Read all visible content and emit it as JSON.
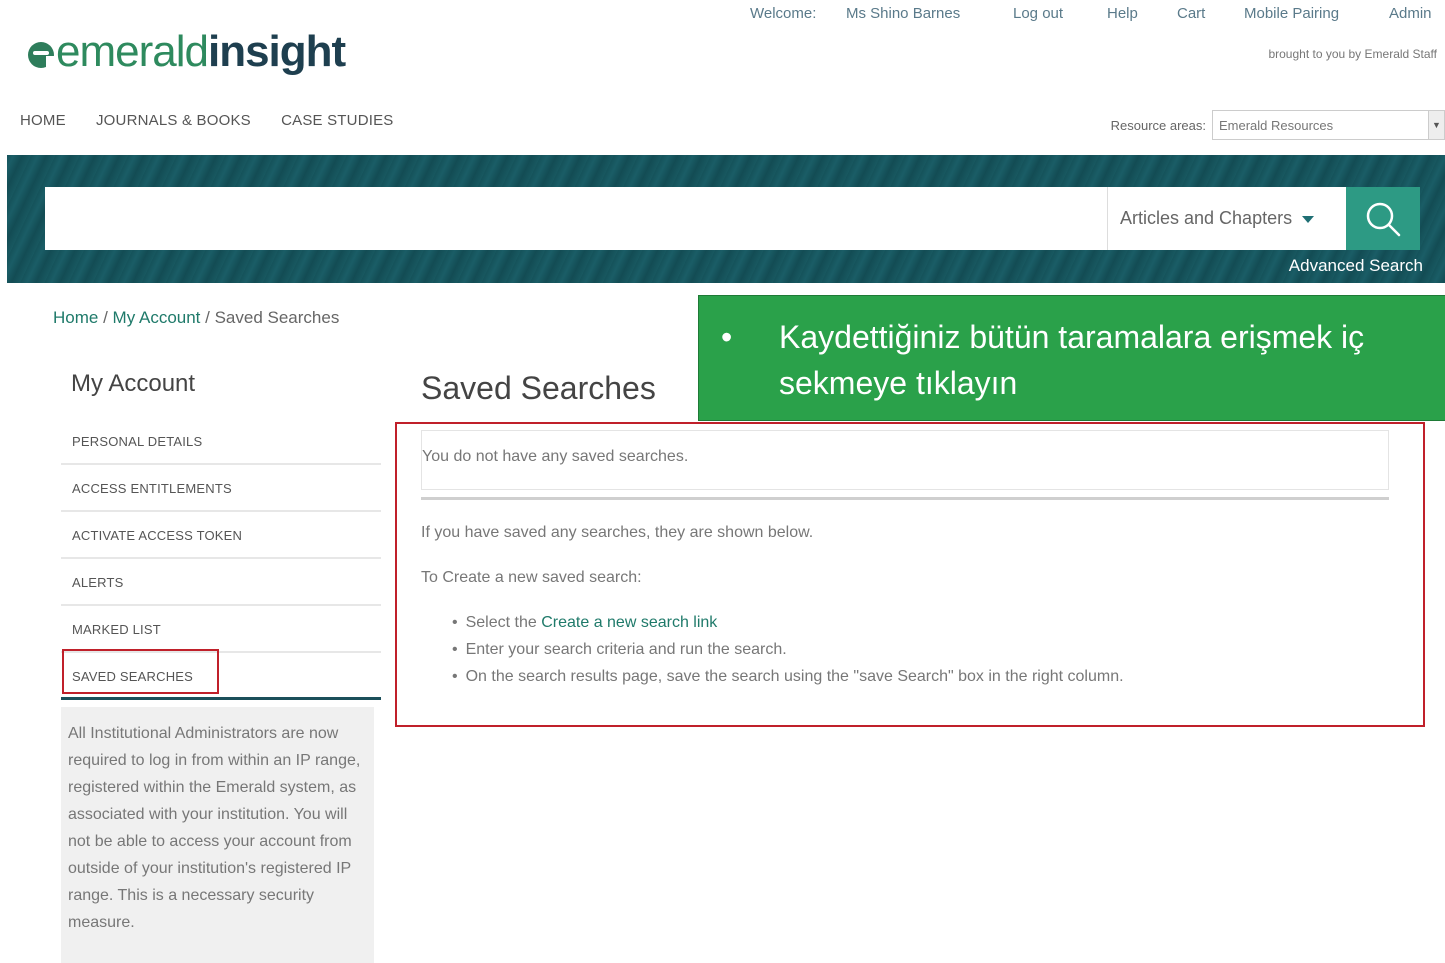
{
  "topbar": {
    "welcome_label": "Welcome:",
    "user_name": "Ms Shino Barnes",
    "logout": "Log out",
    "help": "Help",
    "cart": "Cart",
    "mobile_pairing": "Mobile Pairing",
    "admin": "Admin",
    "brought_by": "brought to you by Emerald Staff"
  },
  "logo": {
    "part1": "emerald",
    "part2": "insight"
  },
  "nav": {
    "home": "HOME",
    "journals": "JOURNALS & BOOKS",
    "cases": "CASE STUDIES"
  },
  "resource": {
    "label": "Resource areas:",
    "value": "Emerald Resources"
  },
  "search": {
    "value": "",
    "scope": "Articles and Chapters",
    "advanced": "Advanced Search"
  },
  "breadcrumb": {
    "home": "Home",
    "sep": " / ",
    "account": "My Account",
    "current": "Saved Searches"
  },
  "sidebar": {
    "title": "My Account",
    "items": [
      {
        "label": "PERSONAL DETAILS"
      },
      {
        "label": "ACCESS ENTITLEMENTS"
      },
      {
        "label": "ACTIVATE ACCESS TOKEN"
      },
      {
        "label": "ALERTS"
      },
      {
        "label": "MARKED LIST"
      },
      {
        "label": "SAVED SEARCHES"
      }
    ],
    "note": "All Institutional Administrators are now required to log in from within an IP range, registered within the Emerald system, as associated with your institution. You will not be able to access your account from outside of your institution's registered IP range. This is a necessary security measure."
  },
  "main": {
    "title": "Saved Searches",
    "empty": "You do not have any saved searches.",
    "shown_below": "If you have saved any searches, they are shown below.",
    "to_create": "To Create a new saved search:",
    "bullet1_prefix": "Select the ",
    "bullet1_link": "Create a new search link",
    "bullet2": "Enter your search criteria and run the search.",
    "bullet3": "On the search results page, save the search using the \"save Search\" box in the right column."
  },
  "tooltip": {
    "bullet": "•",
    "line1": "Kaydettiğiniz bütün taramalara erişmek iç",
    "line2": "sekmeye tıklayın"
  },
  "colors": {
    "brand_green": "#2e8a5e",
    "brand_dark": "#1e3f4f",
    "band": "#15525a",
    "search_button": "#2d9a84",
    "link": "#1f7a6a",
    "highlight_red": "#c0202a",
    "tooltip_green": "#2aa14a"
  }
}
